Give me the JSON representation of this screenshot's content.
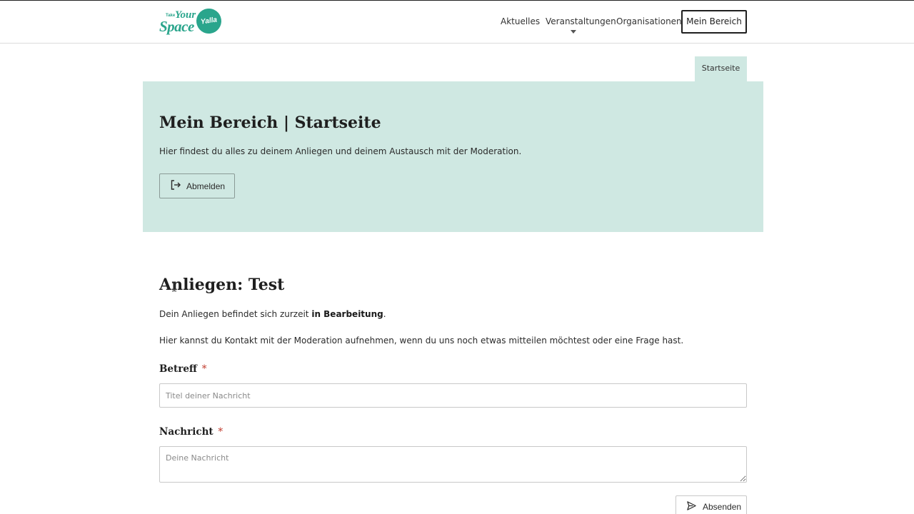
{
  "header": {
    "logo": {
      "small_text": "Take",
      "word_1": "Your",
      "word_2": "Space",
      "badge_text": "Yalla"
    },
    "nav": [
      {
        "label": "Aktuelles"
      },
      {
        "label": "Veranstaltungen",
        "has_dropdown": true
      },
      {
        "label": "Organisationen"
      }
    ],
    "account_button": "Mein Bereich"
  },
  "tabs": {
    "active": "Startseite"
  },
  "hero": {
    "title": "Mein Bereich | Startseite",
    "description": "Hier findest du alles zu deinem Anliegen und deinem Austausch mit der Moderation.",
    "logout_label": "Abmelden",
    "background": "#cfe8e2"
  },
  "concern": {
    "title": "Anliegen: Test",
    "status_prefix": "Dein Anliegen befindet sich zurzeit ",
    "status_value": "in Bearbeitung",
    "status_suffix": ".",
    "contact_text": "Hier kannst du Kontakt mit der Moderation aufnehmen, wenn du uns noch etwas mitteilen möchtest oder eine Frage hast."
  },
  "form": {
    "subject_label": "Betreff",
    "subject_required": "*",
    "subject_placeholder": "Titel deiner Nachricht",
    "message_label": "Nachricht",
    "message_required": "*",
    "message_placeholder": "Deine Nachricht",
    "submit_label": "Absenden"
  },
  "colors": {
    "brand": "#2aa58c",
    "hero_bg": "#cfe8e2",
    "required": "#c0392b"
  }
}
